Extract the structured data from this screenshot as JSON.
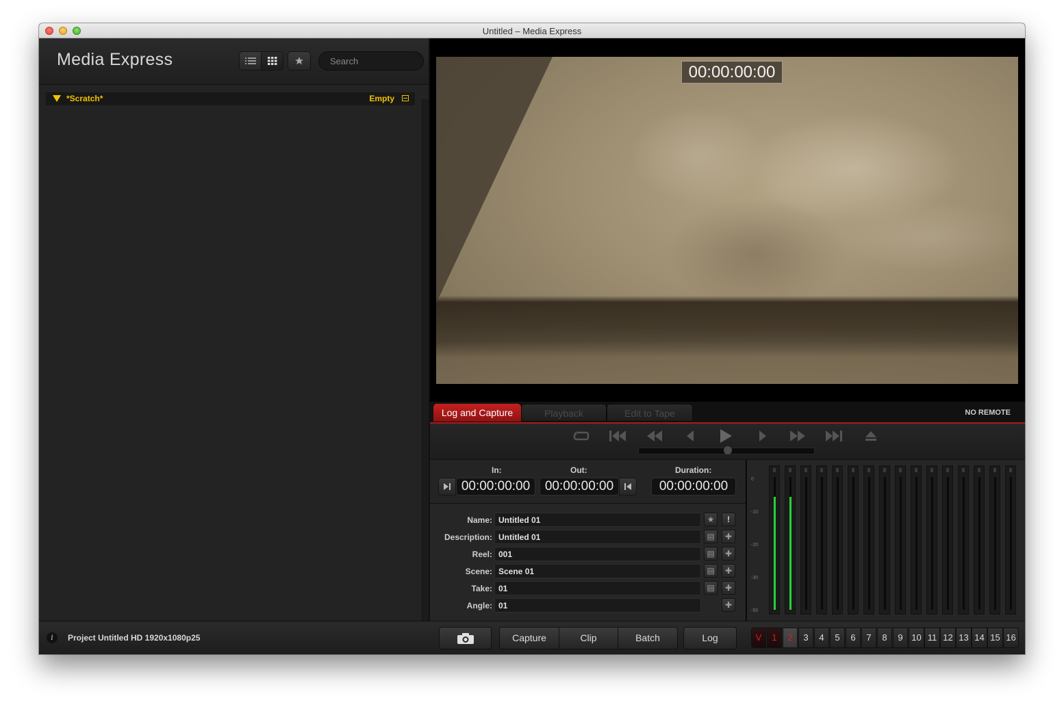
{
  "window": {
    "title": "Untitled – Media Express"
  },
  "left": {
    "app_title": "Media Express",
    "search": {
      "placeholder": "Search"
    },
    "bin": {
      "name": "*Scratch*",
      "status": "Empty"
    }
  },
  "viewer": {
    "timecode": "00:00:00:00"
  },
  "tabs": {
    "items": [
      {
        "label": "Log and Capture",
        "active": true
      },
      {
        "label": "Playback",
        "active": false
      },
      {
        "label": "Edit to Tape",
        "active": false
      }
    ],
    "remote_status": "NO REMOTE"
  },
  "io": {
    "in_label": "In:",
    "in_value": "00:00:00:00",
    "out_label": "Out:",
    "out_value": "00:00:00:00",
    "duration_label": "Duration:",
    "duration_value": "00:00:00:00"
  },
  "fields": [
    {
      "label": "Name:",
      "value": "Untitled 01"
    },
    {
      "label": "Description:",
      "value": "Untitled 01"
    },
    {
      "label": "Reel:",
      "value": "001"
    },
    {
      "label": "Scene:",
      "value": "Scene 01"
    },
    {
      "label": "Take:",
      "value": "01"
    },
    {
      "label": "Angle:",
      "value": "01"
    }
  ],
  "meters": {
    "scale": [
      "0",
      "-10",
      "-20",
      "-30",
      "-50"
    ],
    "levels": [
      0.85,
      0.85,
      0,
      0,
      0,
      0,
      0,
      0,
      0,
      0,
      0,
      0,
      0,
      0,
      0,
      0
    ]
  },
  "bottom": {
    "project_info": "Project Untitled  HD 1920x1080p25",
    "buttons": {
      "capture": "Capture",
      "clip": "Clip",
      "batch": "Batch",
      "log": "Log"
    },
    "channels": [
      "V",
      "1",
      "2",
      "3",
      "4",
      "5",
      "6",
      "7",
      "8",
      "9",
      "10",
      "11",
      "12",
      "13",
      "14",
      "15",
      "16"
    ]
  },
  "colors": {
    "accent": "#b01818",
    "bin": "#f2c200",
    "meter": "#26d13a"
  }
}
